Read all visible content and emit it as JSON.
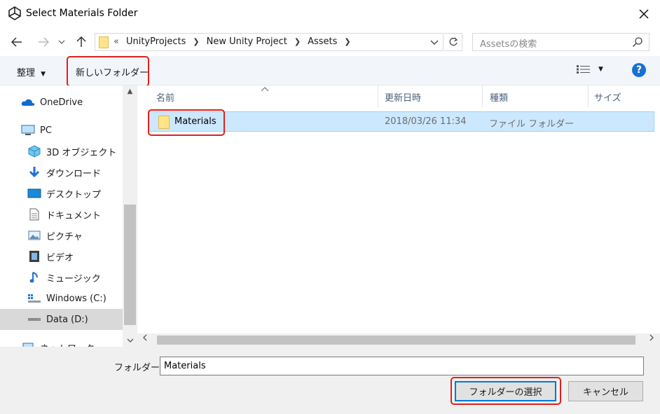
{
  "window": {
    "title": "Select Materials Folder",
    "app_icon": "unity-logo-icon",
    "close_icon": "close-icon"
  },
  "navigation": {
    "breadcrumb": [
      "UnityProjects",
      "New Unity Project",
      "Assets"
    ],
    "overflow": "«",
    "search_placeholder": "Assetsの検索"
  },
  "toolbar": {
    "organize_label": "整理",
    "new_folder_label": "新しいフォルダー"
  },
  "sidebar": {
    "items": [
      {
        "label": "OneDrive",
        "icon": "onedrive-icon"
      },
      {
        "label": "PC",
        "icon": "computer-icon"
      },
      {
        "label": "3D オブジェクト",
        "icon": "3d-objects-icon"
      },
      {
        "label": "ダウンロード",
        "icon": "download-icon"
      },
      {
        "label": "デスクトップ",
        "icon": "desktop-icon"
      },
      {
        "label": "ドキュメント",
        "icon": "document-icon"
      },
      {
        "label": "ピクチャ",
        "icon": "pictures-icon"
      },
      {
        "label": "ビデオ",
        "icon": "video-icon"
      },
      {
        "label": "ミュージック",
        "icon": "music-icon"
      },
      {
        "label": "Windows (C:)",
        "icon": "windows-drive-icon"
      },
      {
        "label": "Data (D:)",
        "icon": "drive-icon"
      },
      {
        "label": "ネットワーク",
        "icon": "network-icon"
      }
    ],
    "selected": "Data (D:)"
  },
  "list": {
    "columns": [
      "名前",
      "更新日時",
      "種類",
      "サイズ"
    ],
    "rows": [
      {
        "name": "Materials",
        "modified": "2018/03/26 11:34",
        "type": "ファイル フォルダー",
        "size": ""
      }
    ]
  },
  "footer": {
    "folder_label": "フォルダー:",
    "folder_value": "Materials",
    "select_button": "フォルダーの選択",
    "cancel_button": "キャンセル"
  },
  "colors": {
    "highlight": "#e0201c",
    "selection": "#cce8ff",
    "accent": "#0078d7"
  }
}
